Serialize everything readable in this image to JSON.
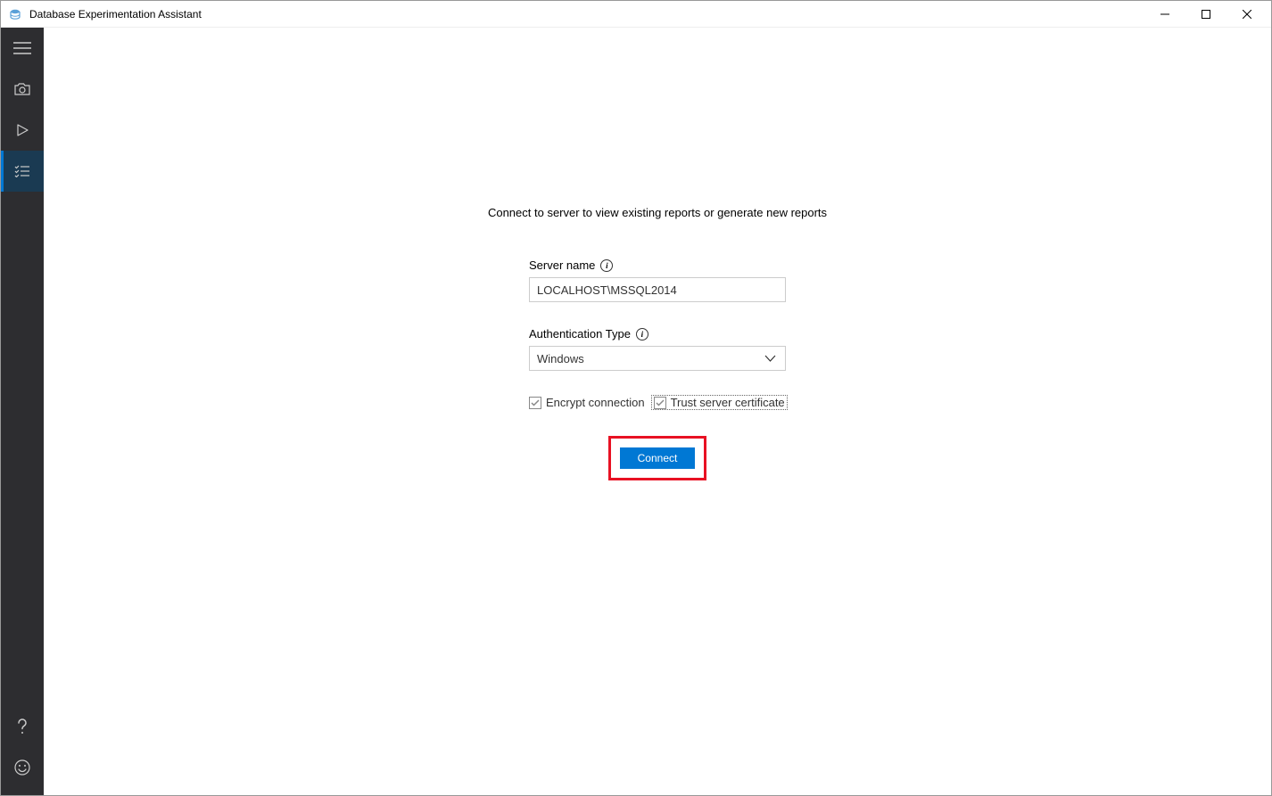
{
  "window": {
    "title": "Database Experimentation Assistant"
  },
  "sidebar": {
    "items": [
      {
        "name": "hamburger-menu"
      },
      {
        "name": "capture"
      },
      {
        "name": "replay"
      },
      {
        "name": "reports"
      }
    ]
  },
  "main": {
    "instruction": "Connect to server to view existing reports or generate new reports",
    "server_name_label": "Server name",
    "server_name_value": "LOCALHOST\\MSSQL2014",
    "auth_type_label": "Authentication Type",
    "auth_type_value": "Windows",
    "encrypt_label": "Encrypt connection",
    "encrypt_checked": true,
    "trust_label": "Trust server certificate",
    "trust_checked": true,
    "connect_label": "Connect"
  },
  "icons": {
    "info": "i"
  }
}
